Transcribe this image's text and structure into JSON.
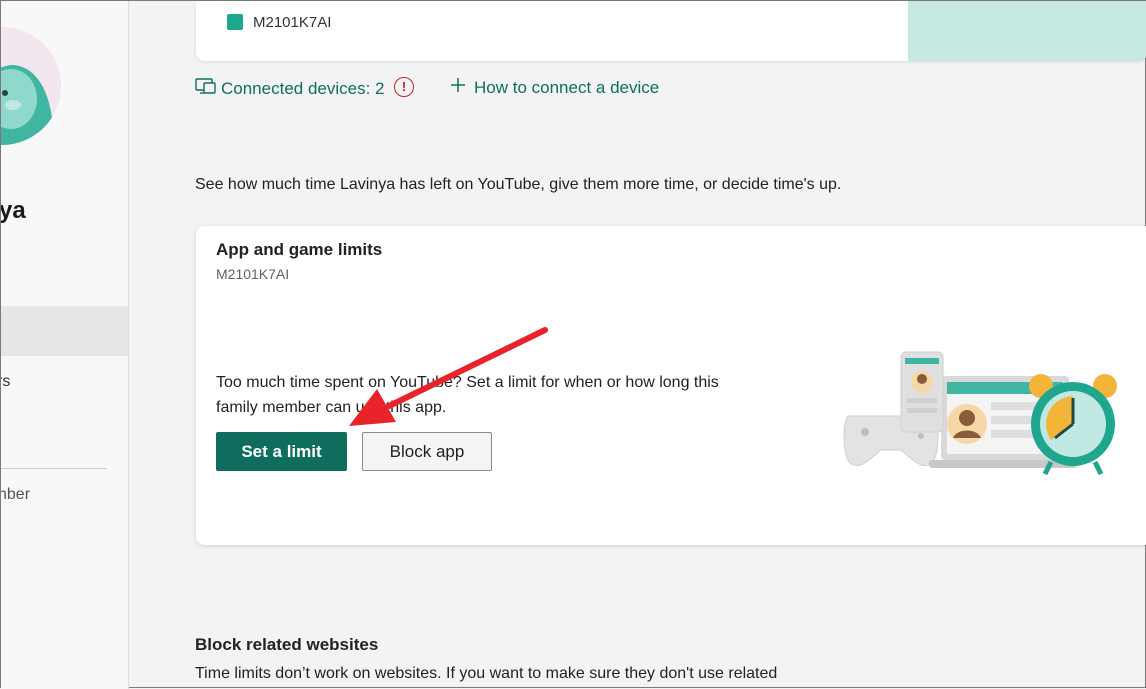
{
  "sidebar": {
    "name": "ya",
    "item_1": "rs",
    "item_2": "nber"
  },
  "device_card": {
    "device_name": "M2101K7AI"
  },
  "links": {
    "connected_devices": "Connected devices: 2",
    "alert_glyph": "!",
    "how_to_connect": "How to connect a device"
  },
  "intro": "See how much time Lavinya has left on YouTube, give them more time, or decide time's up.",
  "limits_card": {
    "title": "App and game limits",
    "device": "M2101K7AI",
    "description": "Too much time spent on YouTube? Set a limit for when or how long this family member can use this app.",
    "set_limit_label": "Set a limit",
    "block_app_label": "Block app"
  },
  "block_websites": {
    "heading": "Block related websites",
    "text": "Time limits don’t work on websites. If you want to make sure they don't use related"
  },
  "colors": {
    "accent": "#0f6d5e",
    "link": "#0f6f5f",
    "annotation_arrow": "#e8232a"
  },
  "icons": [
    "devices-icon",
    "alert-icon",
    "plus-icon"
  ]
}
